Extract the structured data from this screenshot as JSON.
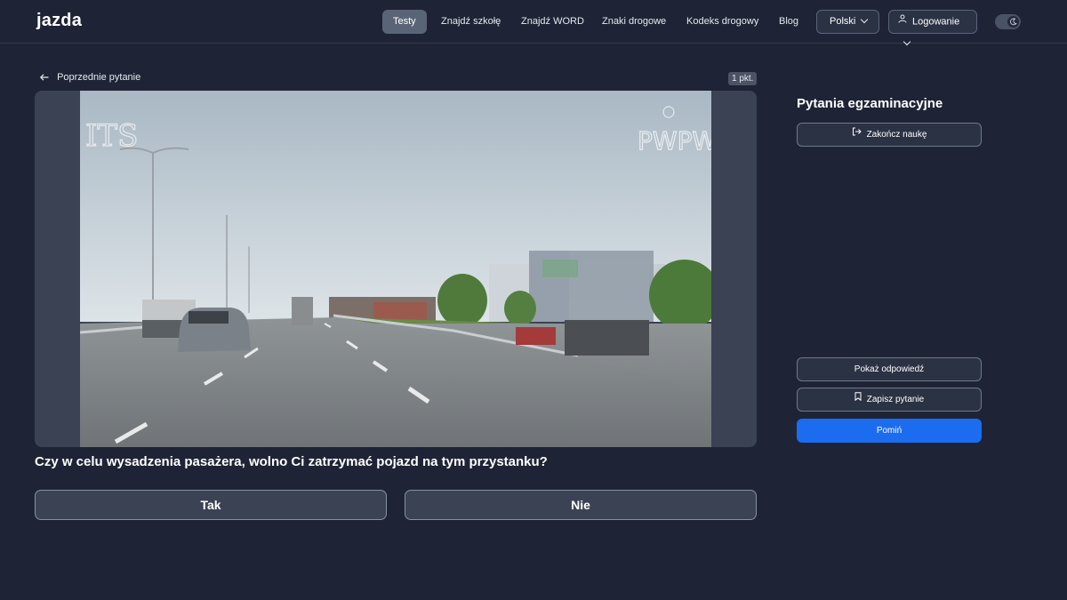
{
  "header": {
    "logo_text": "jazda",
    "nav": [
      "Testy",
      "Znajdź szkołę",
      "Znajdź WORD",
      "Znaki drogowe",
      "Kodeks drogowy",
      "Blog"
    ],
    "active_nav": "Testy",
    "language_label": "Polski",
    "login_label": "Logowanie",
    "icons": {
      "user": "user-icon",
      "chevron": "chevron-down-icon",
      "theme": "moon-icon"
    }
  },
  "question_panel": {
    "prev_label": "Poprzednie pytanie",
    "points": "1 pkt.",
    "watermarks": [
      "ITS",
      "PWPW"
    ],
    "question_text": "Czy w celu wysadzenia pasażera, wolno Ci zatrzymać pojazd na tym przystanku?",
    "answers": [
      "Tak",
      "Nie"
    ]
  },
  "sidebar": {
    "title": "Pytania egzaminacyjne",
    "finish_label": "Zakończ naukę",
    "show_answer_label": "Pokaż odpowiedź",
    "save_label": "Zapisz pytanie",
    "skip_label": "Pomiń"
  },
  "colors": {
    "background": "#1e2435",
    "accent": "#1c6cf0",
    "logo_accent": "#2b7bff"
  }
}
